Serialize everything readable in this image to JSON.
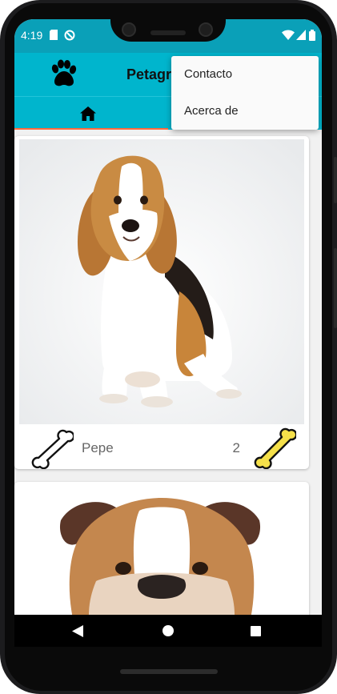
{
  "status_bar": {
    "time": "4:19",
    "icons": [
      "sd-card-icon",
      "data-saver-icon",
      "wifi-icon",
      "signal-icon",
      "battery-icon"
    ]
  },
  "app_bar": {
    "title": "Petagram",
    "logo_icon": "paw-icon"
  },
  "tabs": [
    {
      "icon": "home-icon",
      "selected": true
    }
  ],
  "overflow_menu": {
    "items": [
      {
        "label": "Contacto"
      },
      {
        "label": "Acerca de"
      }
    ]
  },
  "feed": {
    "cards": [
      {
        "name": "Pepe",
        "likes": "2",
        "photo": "beagle",
        "like_icon": "bone-outline-icon",
        "count_icon": "bone-filled-icon"
      },
      {
        "name": "",
        "likes": "",
        "photo": "bulldog"
      }
    ]
  },
  "colors": {
    "primary": "#00b5cd",
    "primary_dark": "#0aa0b8",
    "tab_indicator": "#ff6a3d",
    "bone_fill": "#f5e04a"
  }
}
